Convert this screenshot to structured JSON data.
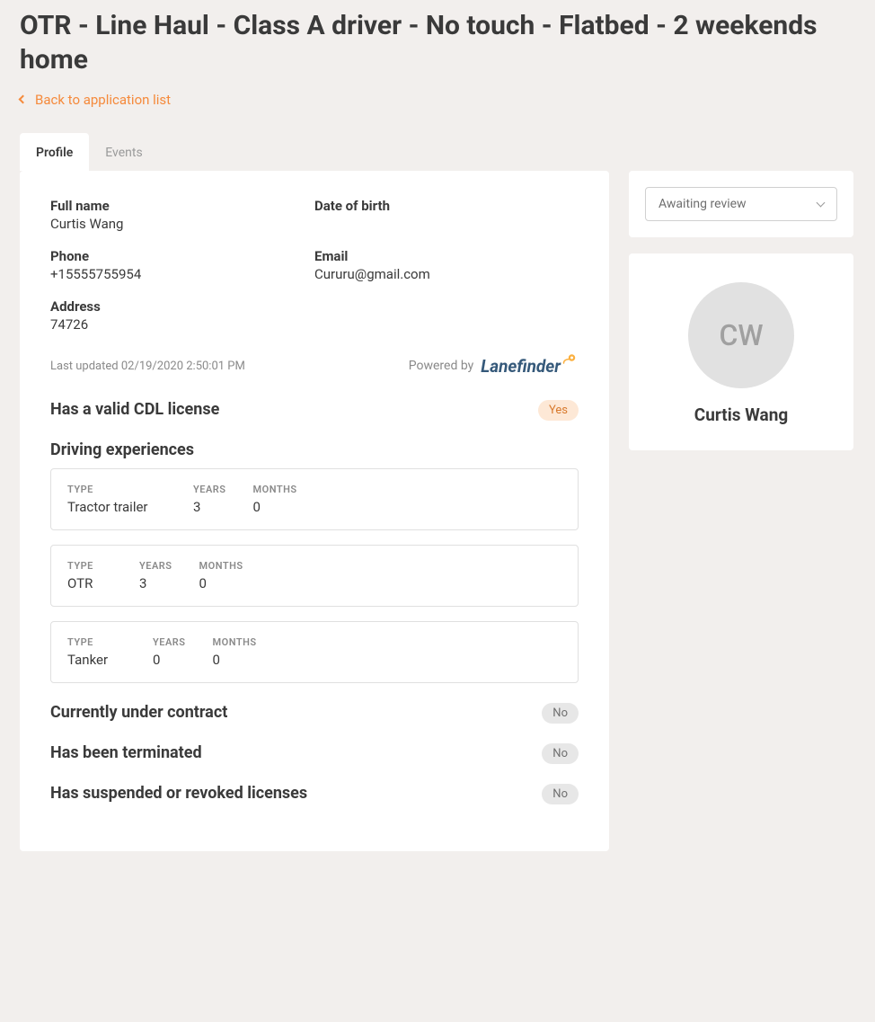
{
  "page_title": "OTR - Line Haul - Class A driver - No touch - Flatbed - 2 weekends home",
  "back_link_label": "Back to application list",
  "tabs": {
    "profile": "Profile",
    "events": "Events"
  },
  "status": {
    "selected": "Awaiting review"
  },
  "applicant": {
    "initials": "CW",
    "display_name": "Curtis Wang"
  },
  "profile": {
    "labels": {
      "full_name": "Full name",
      "dob": "Date of birth",
      "phone": "Phone",
      "email": "Email",
      "address": "Address"
    },
    "full_name": "Curtis Wang",
    "dob": "",
    "phone": "+15555755954",
    "email": "Cururu@gmail.com",
    "address": "74726",
    "last_updated_label": "Last updated",
    "last_updated_value": "02/19/2020 2:50:01 PM",
    "powered_by_label": "Powered by",
    "powered_by_brand": "Lanefinder"
  },
  "sections": {
    "cdl": {
      "title": "Has a valid CDL license",
      "badge": "Yes"
    },
    "driving_exp": {
      "title": "Driving experiences",
      "column_labels": {
        "type": "TYPE",
        "years": "YEARS",
        "months": "MONTHS"
      },
      "rows": [
        {
          "type": "Tractor trailer",
          "years": "3",
          "months": "0"
        },
        {
          "type": "OTR",
          "years": "3",
          "months": "0"
        },
        {
          "type": "Tanker",
          "years": "0",
          "months": "0"
        }
      ]
    },
    "under_contract": {
      "title": "Currently under contract",
      "badge": "No"
    },
    "terminated": {
      "title": "Has been terminated",
      "badge": "No"
    },
    "suspended": {
      "title": "Has suspended or revoked licenses",
      "badge": "No"
    }
  }
}
